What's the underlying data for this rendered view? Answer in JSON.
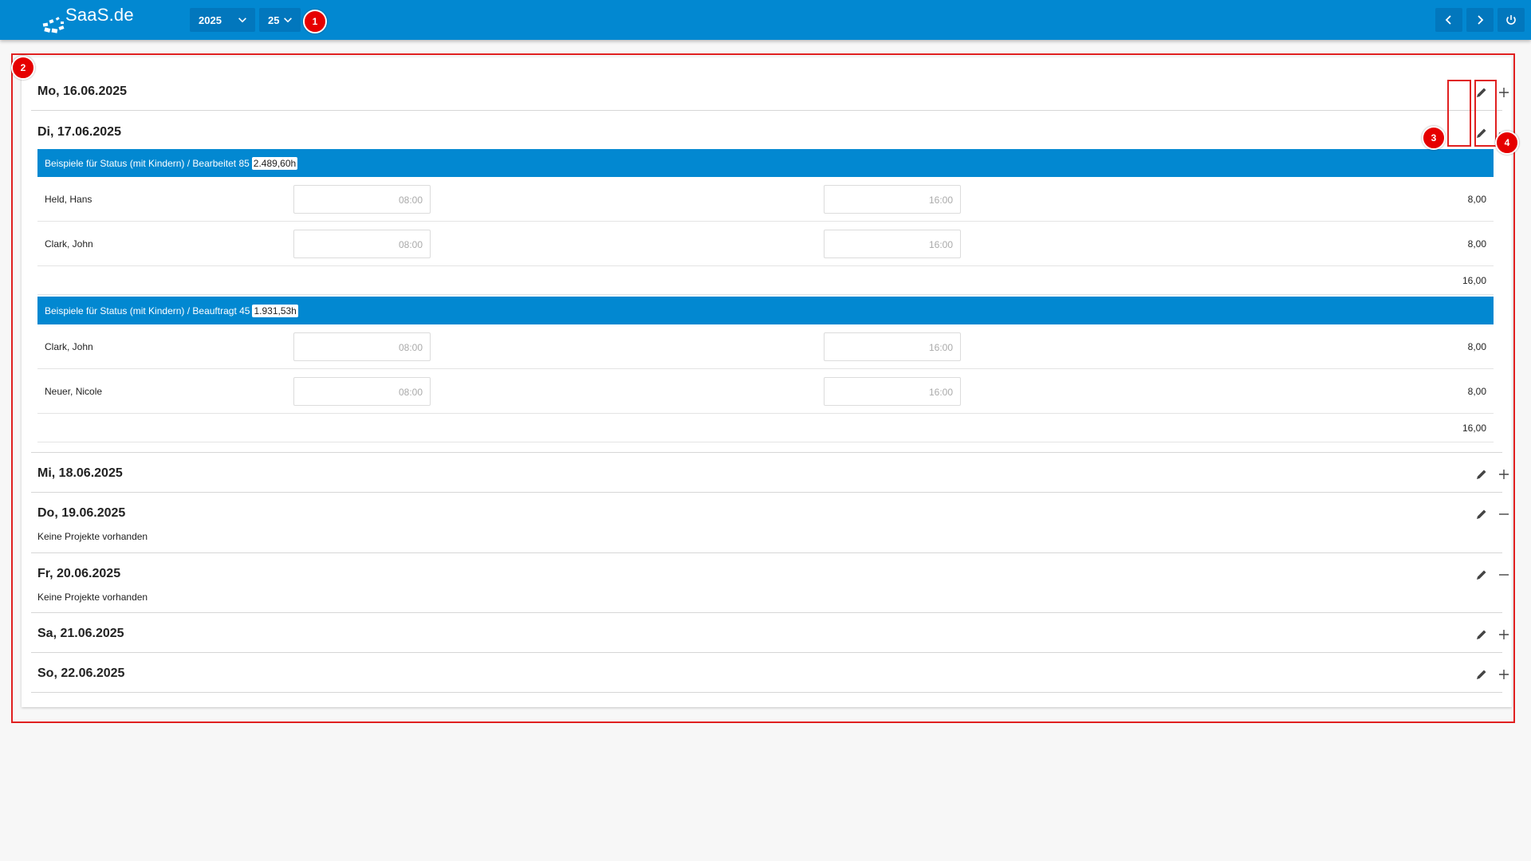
{
  "header": {
    "logo_text": "SaaS.de",
    "year_select": "2025",
    "week_select": "25",
    "brand_color": "#0288d1",
    "buttons": [
      "chevron-left-icon",
      "chevron-right-icon",
      "power-icon"
    ]
  },
  "annotations": [
    "1",
    "2",
    "3",
    "4"
  ],
  "days": {
    "mon": {
      "title": "Mo, 16.06.2025"
    },
    "tue": {
      "title": "Di, 17.06.2025",
      "projects": [
        {
          "label": "Beispiele für Status (mit Kindern) / Bearbeitet 85",
          "hours": "2.489,60h",
          "rows": [
            {
              "name": "Held, Hans",
              "start": "08:00",
              "end": "16:00",
              "hours": "8,00"
            },
            {
              "name": "Clark, John",
              "start": "08:00",
              "end": "16:00",
              "hours": "8,00"
            }
          ],
          "total": "16,00"
        },
        {
          "label": "Beispiele für Status (mit Kindern) / Beauftragt 45",
          "hours": "1.931,53h",
          "rows": [
            {
              "name": "Clark, John",
              "start": "08:00",
              "end": "16:00",
              "hours": "8,00"
            },
            {
              "name": "Neuer, Nicole",
              "start": "08:00",
              "end": "16:00",
              "hours": "8,00"
            }
          ],
          "total": "16,00"
        }
      ]
    },
    "wed": {
      "title": "Mi, 18.06.2025"
    },
    "thu": {
      "title": "Do, 19.06.2025",
      "empty_text": "Keine Projekte vorhanden"
    },
    "fri": {
      "title": "Fr, 20.06.2025",
      "empty_text": "Keine Projekte vorhanden"
    },
    "sat": {
      "title": "Sa, 21.06.2025"
    },
    "sun": {
      "title": "So, 22.06.2025"
    }
  }
}
